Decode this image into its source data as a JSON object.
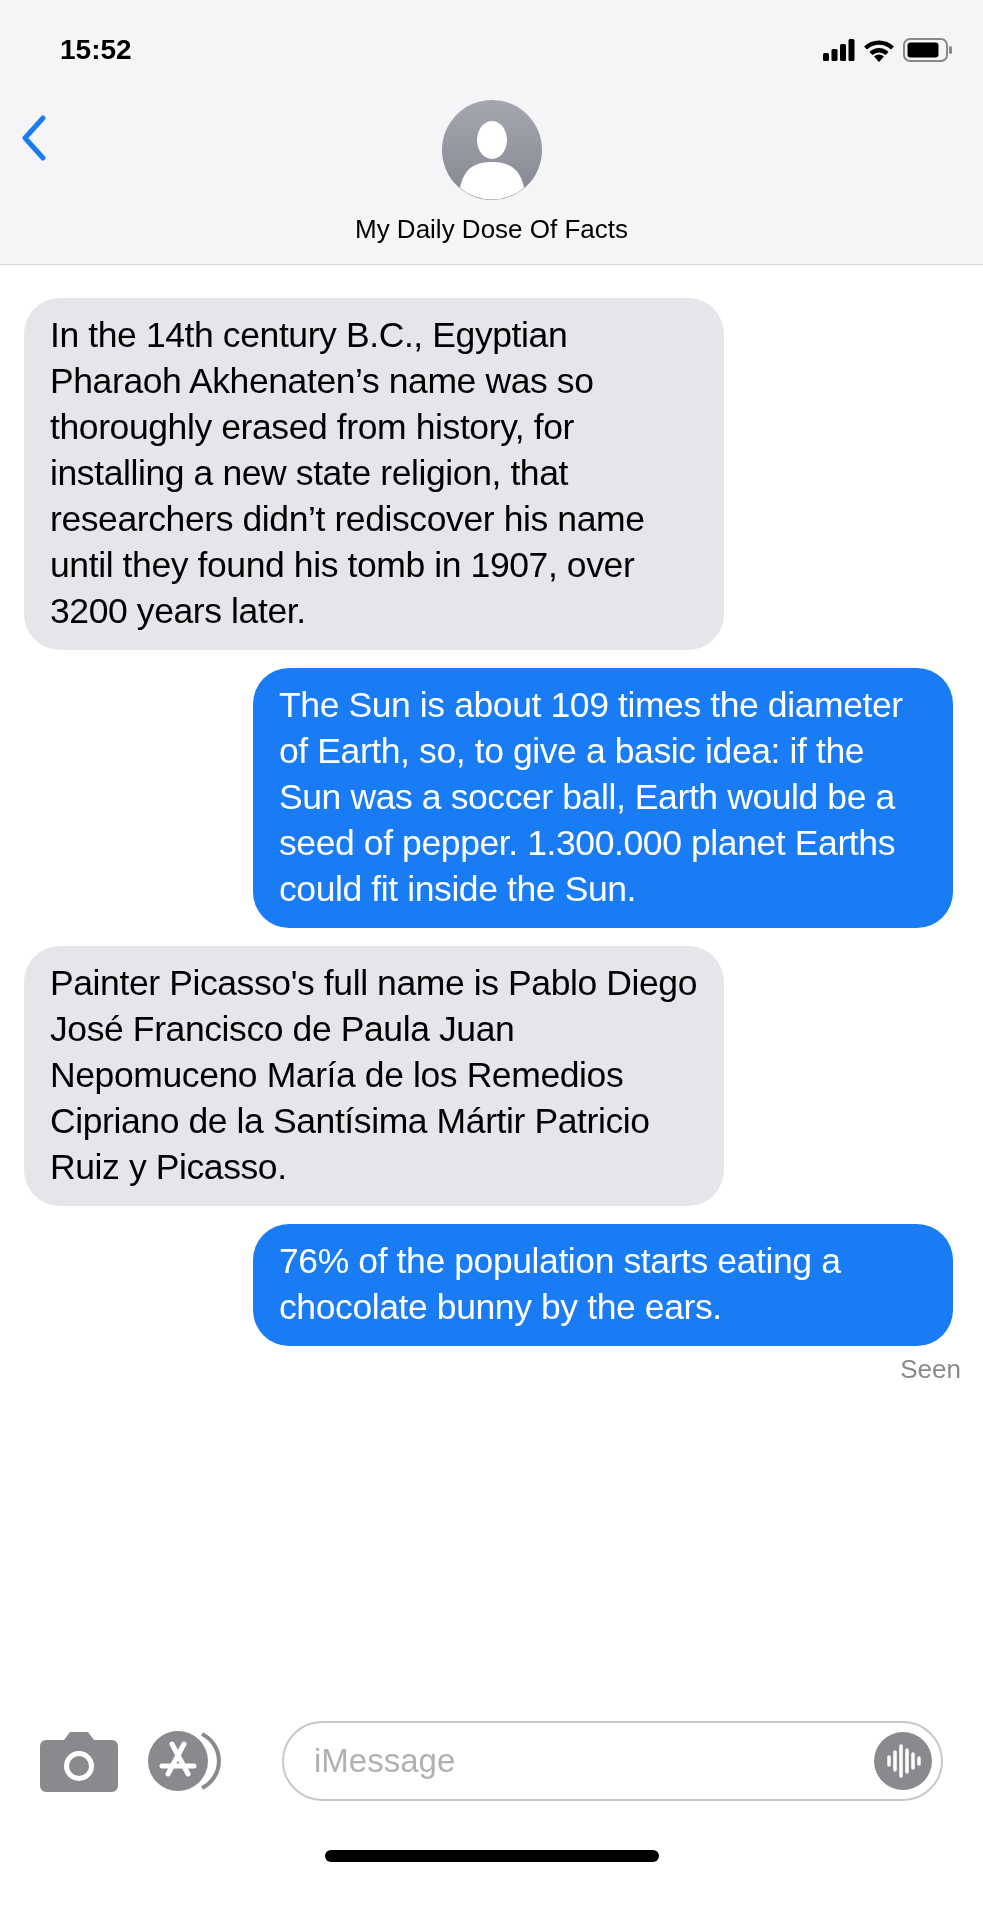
{
  "status_bar": {
    "time": "15:52"
  },
  "header": {
    "contact_name": "My Daily Dose Of Facts"
  },
  "messages": [
    {
      "kind": "incoming",
      "text": "In the 14th century B.C., Egyptian Pharaoh Akhenaten’s name was so thoroughly erased from history, for installing a new state religion, that researchers didn’t rediscover his name until they found his tomb in 1907, over 3200 years later."
    },
    {
      "kind": "outgoing",
      "text": "The Sun is about 109 times the diameter of Earth, so, to give a basic idea: if the Sun was a soccer ball, Earth would be a seed of pepper. 1.300.000 planet Earths could fit inside the Sun."
    },
    {
      "kind": "incoming",
      "text": "Painter Picasso's full name is Pablo Diego José Francisco de Paula Juan Nepomuceno María de los Remedios Cipriano de la Santísima Mártir Patricio Ruiz y Picasso."
    },
    {
      "kind": "outgoing",
      "text": "76% of the population starts eating a chocolate bunny by the ears."
    }
  ],
  "receipt": "Seen",
  "composer": {
    "placeholder": "iMessage"
  }
}
